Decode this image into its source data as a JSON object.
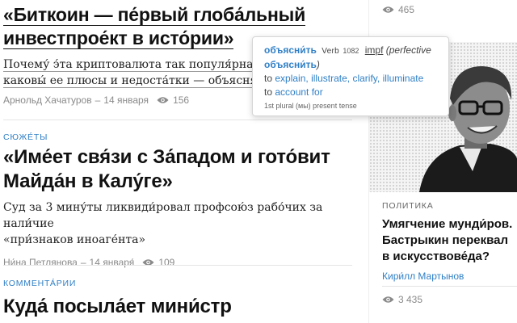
{
  "articles": [
    {
      "title": "«Биткоин — пе́рвый глоба́льный инвестпрое́кт в исто́рии»",
      "title_lines": [
        "«Биткоин — пе́рвый глоба́льный",
        "инвестпрое́кт в исто́рии»"
      ],
      "lede_lines": [
        "Почему́ э́та криптовалюта так популя́рна и как",
        "каковы́ ее плюсы и недоста́тки — объясняем"
      ],
      "author": "Арнольд Хачатуров",
      "date": "14 января",
      "views": "156"
    },
    {
      "rubric": "СЮЖЕ́ТЫ",
      "title_lines": [
        "«Име́ет свя́зи с За́падом и гото́вит",
        "Майда́н в Калу́ге»"
      ],
      "lede_lines": [
        "Суд за 3 мину́ты ликвиди́ровал профсою́з рабо́чих за нали́чие",
        "«при́знаков иноаге́нта»"
      ],
      "author": "Ни́на Петлянова",
      "date": "14 января́",
      "views": "109"
    },
    {
      "rubric": "КОММЕНТА́РИИ",
      "title_lines": [
        "Куда́ посыла́ет мини́стр"
      ]
    }
  ],
  "popup": {
    "word": "объясни́ть",
    "pos": "Verb",
    "rank": "1082",
    "aspect": "impf",
    "perfective_label": "(perfective",
    "perfective_word": "объясни́ть",
    "perfective_close": ")",
    "to1": "to",
    "translations": [
      "explain,",
      "illustrate,",
      "clarify,",
      "illuminate"
    ],
    "to2": "to",
    "translation2": "account for",
    "form_note": "1st plural (мы) present tense"
  },
  "sidebar": {
    "top_views": "465",
    "rubric": "ПОЛИТИКА",
    "title_lines": [
      "Умягчение мунди́ров.",
      "Бастрыкин переквал",
      "в искусствове́да?"
    ],
    "author": "Кири́лл Мартынов",
    "views": "3 435"
  },
  "colors": {
    "accent": "#2f7fc6",
    "meta": "#8a8a8a",
    "divider": "#e4e4e4"
  }
}
